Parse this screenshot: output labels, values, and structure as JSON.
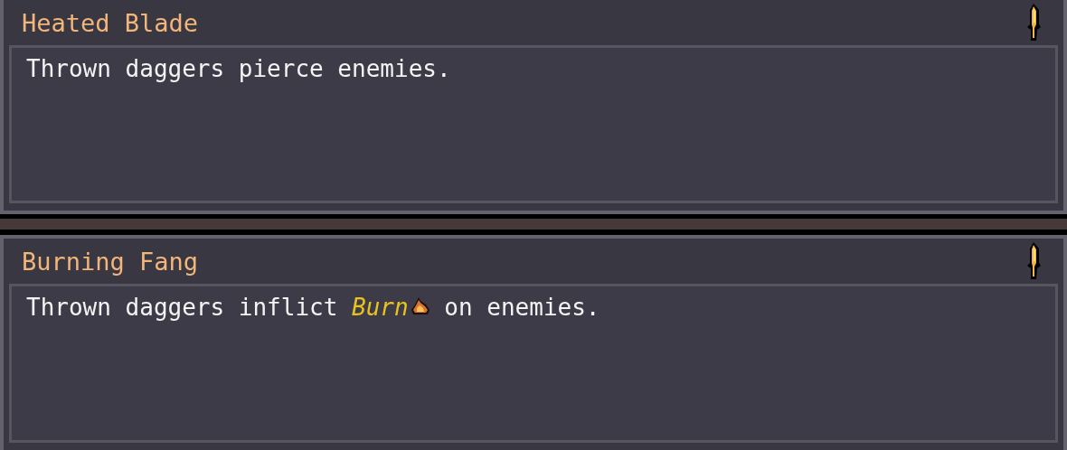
{
  "cards": [
    {
      "title": "Heated Blade",
      "description": [
        {
          "kind": "text",
          "text": "Thrown daggers pierce enemies."
        }
      ]
    },
    {
      "title": "Burning Fang",
      "description": [
        {
          "kind": "text",
          "text": "Thrown daggers inflict "
        },
        {
          "kind": "keyword",
          "text": "Burn"
        },
        {
          "kind": "text",
          "text": " on enemies."
        }
      ]
    }
  ]
}
